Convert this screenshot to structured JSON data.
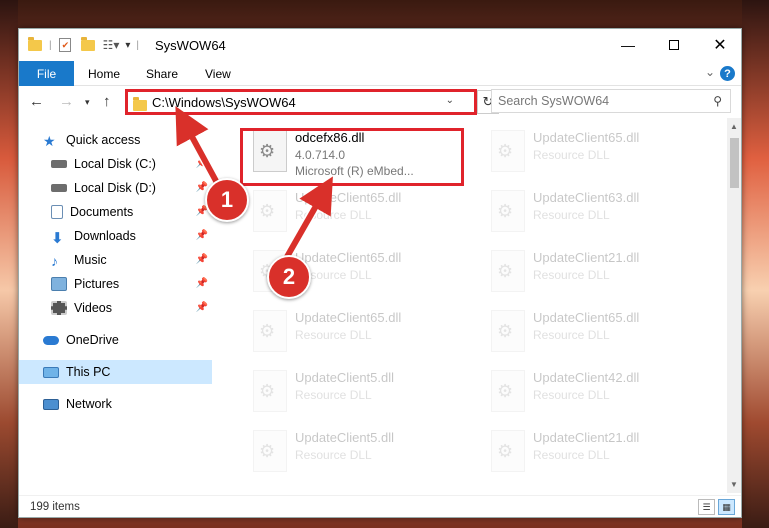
{
  "window": {
    "title": "SysWOW64"
  },
  "ribbon": {
    "tabs": [
      "File",
      "Home",
      "Share",
      "View"
    ]
  },
  "nav": {
    "address": "C:\\Windows\\SysWOW64",
    "search_placeholder": "Search SysWOW64"
  },
  "sidebar": {
    "items": [
      {
        "label": "Quick access",
        "icon": "star-icon"
      },
      {
        "label": "Local Disk (C:)",
        "icon": "drive-icon"
      },
      {
        "label": "Local Disk (D:)",
        "icon": "drive-icon"
      },
      {
        "label": "Documents",
        "icon": "documents-icon"
      },
      {
        "label": "Downloads",
        "icon": "download-icon"
      },
      {
        "label": "Music",
        "icon": "music-icon"
      },
      {
        "label": "Pictures",
        "icon": "pictures-icon"
      },
      {
        "label": "Videos",
        "icon": "videos-icon"
      },
      {
        "label": "OneDrive",
        "icon": "cloud-icon"
      },
      {
        "label": "This PC",
        "icon": "computer-icon"
      },
      {
        "label": "Network",
        "icon": "network-icon"
      }
    ]
  },
  "files": {
    "highlighted": {
      "name": "odcefx86.dll",
      "version": "4.0.714.0",
      "company": "Microsoft (R) eMbed..."
    },
    "col1": [
      {
        "name": "UpdateClient65.dll",
        "type": "Resource DLL"
      },
      {
        "name": "UpdateClient65.dll",
        "type": "Resource DLL"
      },
      {
        "name": "UpdateClient65.dll",
        "type": "Resource DLL"
      },
      {
        "name": "UpdateClient5.dll",
        "type": "Resource DLL"
      },
      {
        "name": "UpdateClient5.dll",
        "type": "Resource DLL"
      }
    ],
    "col2": [
      {
        "name": "UpdateClient65.dll",
        "type": "Resource DLL"
      },
      {
        "name": "UpdateClient63.dll",
        "type": "Resource DLL"
      },
      {
        "name": "UpdateClient21.dll",
        "type": "Resource DLL"
      },
      {
        "name": "UpdateClient65.dll",
        "type": "Resource DLL"
      },
      {
        "name": "UpdateClient42.dll",
        "type": "Resource DLL"
      },
      {
        "name": "UpdateClient21.dll",
        "type": "Resource DLL"
      }
    ]
  },
  "status": {
    "items": "199 items"
  },
  "callouts": {
    "one": "1",
    "two": "2"
  },
  "colors": {
    "accent": "#1979ca",
    "callout": "#d9302a",
    "highlight_border": "#e0232b"
  }
}
